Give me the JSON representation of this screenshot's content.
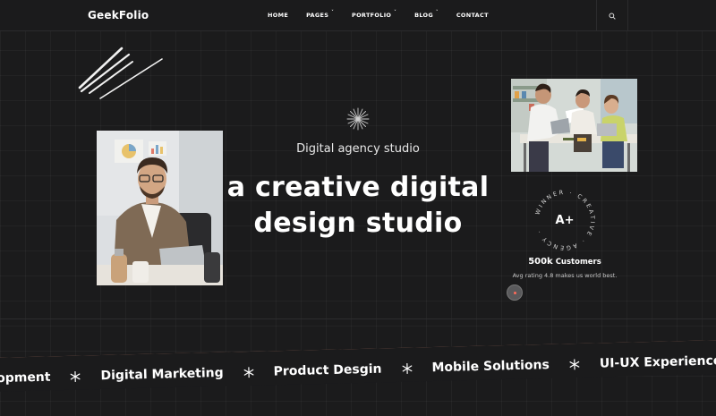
{
  "brand": {
    "name": "GeekFolio"
  },
  "nav": {
    "items": [
      {
        "label": "HOME",
        "has_dropdown": false
      },
      {
        "label": "PAGES",
        "has_dropdown": true
      },
      {
        "label": "PORTFOLIO",
        "has_dropdown": true
      },
      {
        "label": "BLOG",
        "has_dropdown": true
      },
      {
        "label": "CONTACT",
        "has_dropdown": false
      }
    ],
    "search_icon": "search-icon"
  },
  "hero": {
    "tagline": "Digital agency studio",
    "headline_line1": "a creative digital",
    "headline_line2": "design studio"
  },
  "badge": {
    "ring_text": "WINNER · CREATIVE · AGENCY ·",
    "grade": "A+"
  },
  "stats": {
    "customers_value": "500k",
    "customers_label": "Customers",
    "rating_text": "Avg rating 4.8 makes us world best."
  },
  "marquee": {
    "items": [
      "opment",
      "Digital Marketing",
      "Product Desgin",
      "Mobile Solutions",
      "UI-UX Experience"
    ],
    "separator_icon": "snowflake-icon"
  },
  "colors": {
    "background": "#1b1b1c",
    "accent_band": "#e9987e",
    "cursor_dot": "#ff6b5a"
  }
}
